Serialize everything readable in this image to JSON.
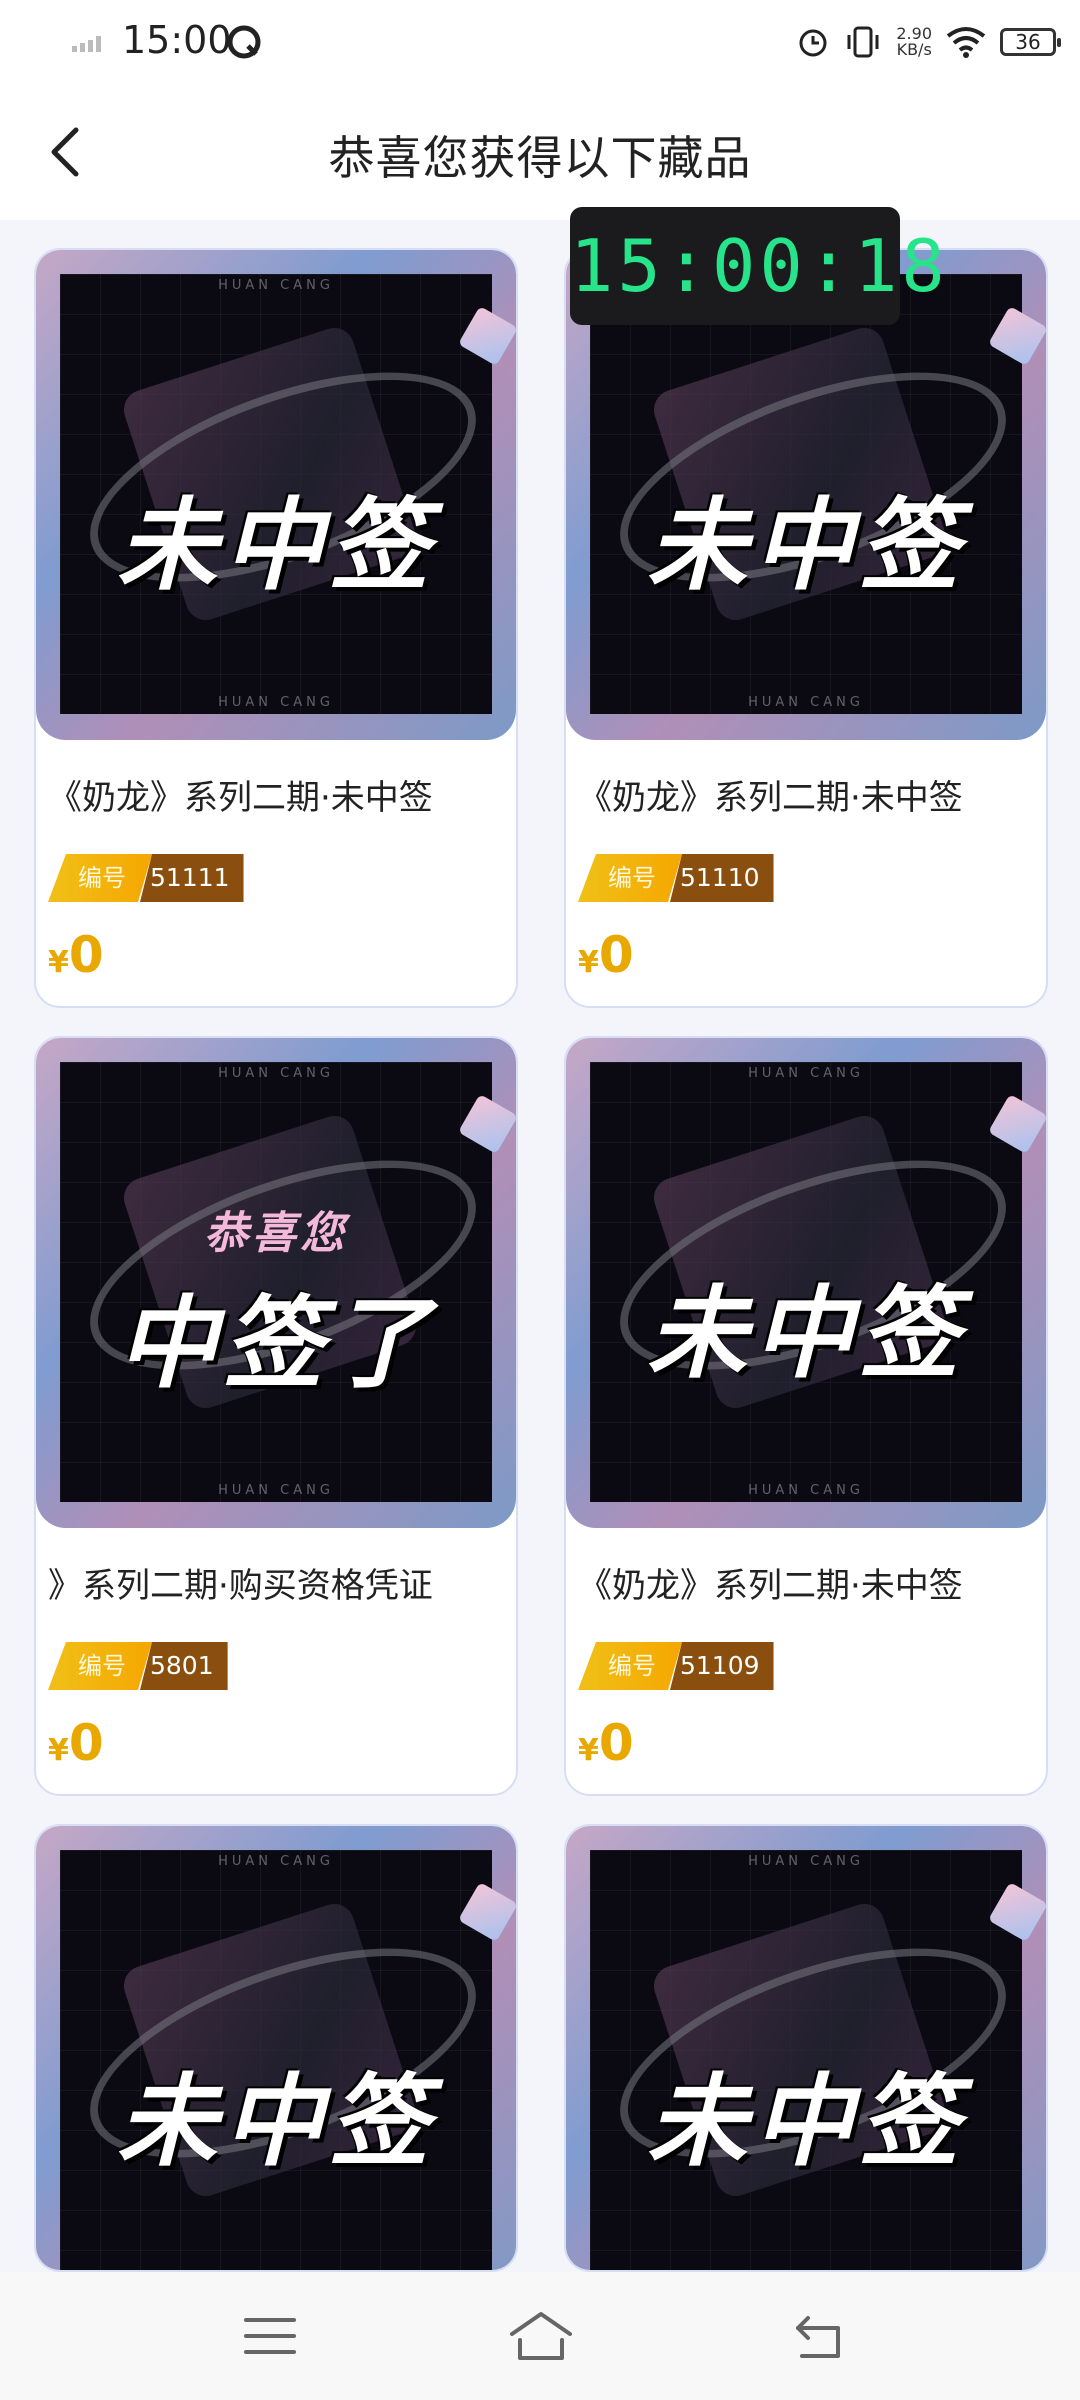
{
  "status_bar": {
    "time": "15:00",
    "net_speed_value": "2.90",
    "net_speed_unit": "KB/s",
    "battery": "36"
  },
  "header": {
    "title": "恭喜您获得以下藏品"
  },
  "timer": {
    "time": "15:00:18"
  },
  "colors": {
    "accent_gold": "#e9a800",
    "serial_dark": "#8a4f0e",
    "timer_green": "#27e38a"
  },
  "cards": [
    {
      "stamp": "未中签",
      "stamp_sub": "",
      "title": "《奶龙》系列二期·未中签",
      "serial_label": "编号",
      "serial": "51111",
      "currency": "¥",
      "price": "0"
    },
    {
      "stamp": "未中签",
      "stamp_sub": "",
      "title": "《奶龙》系列二期·未中签",
      "serial_label": "编号",
      "serial": "51110",
      "currency": "¥",
      "price": "0"
    },
    {
      "stamp": "中签了",
      "stamp_sub": "恭喜您",
      "title": "》系列二期·购买资格凭证",
      "serial_label": "编号",
      "serial": "5801",
      "currency": "¥",
      "price": "0"
    },
    {
      "stamp": "未中签",
      "stamp_sub": "",
      "title": "《奶龙》系列二期·未中签",
      "serial_label": "编号",
      "serial": "51109",
      "currency": "¥",
      "price": "0"
    },
    {
      "stamp": "未中签",
      "stamp_sub": ""
    },
    {
      "stamp": "未中签",
      "stamp_sub": ""
    }
  ],
  "brand_watermark": "HUAN CANG"
}
